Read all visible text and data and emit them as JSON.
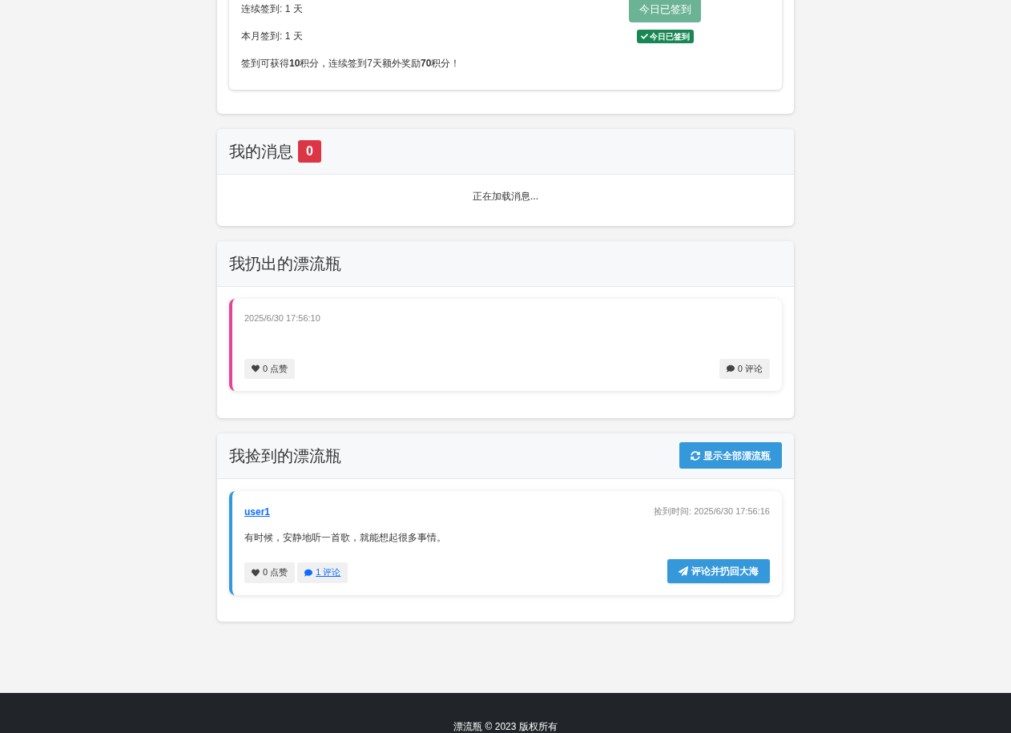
{
  "checkin": {
    "lines": [
      "连续签到: 1 天",
      "本月签到: 1 天",
      "签到可获得**10**积分，连续签到7天额外奖励**70**积分！"
    ],
    "button": {
      "label": "今日已签到",
      "disabled": true
    },
    "badge": "今日已签到"
  },
  "messages": {
    "title": "我的消息",
    "count": "0",
    "status": "正在加载消息..."
  },
  "thrown": {
    "title": "我扔出的漂流瓶",
    "bottles": [
      {
        "time": "2025/6/30 17:56:10",
        "likes": "0 点赞",
        "comments": "0 评论"
      }
    ]
  },
  "picked": {
    "title": "我捡到的漂流瓶",
    "action": "显示全部漂流瓶",
    "bottles": [
      {
        "user": "user1",
        "time": "捡到时间: 2025/6/30 17:56:16",
        "content": "有时候，安静地听一首歌，就能想起很多事情。",
        "likes": "0 点赞",
        "comments": "1 评论",
        "reply": "评论并扔回大海"
      }
    ]
  },
  "footer": "漂流瓶 © 2023 版权所有"
}
